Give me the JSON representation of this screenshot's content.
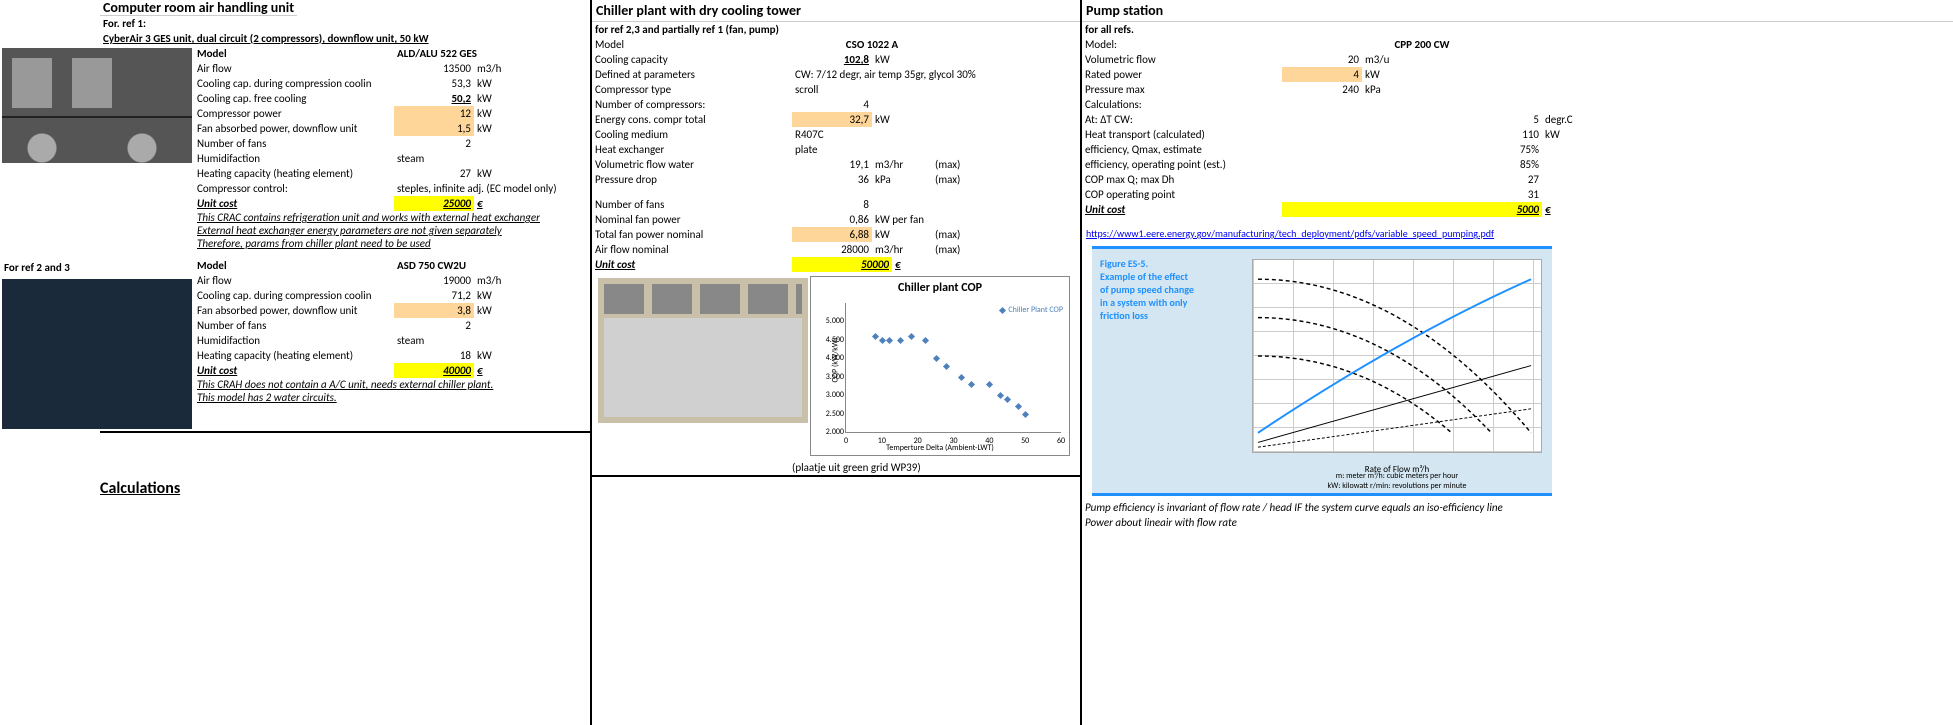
{
  "sec1": {
    "title": "Computer room air handling unit",
    "ref1_label": "For. ref 1:",
    "ref1_desc": "CyberAir 3 GES unit, dual circuit (2 compressors), downflow unit, 50 kW",
    "model_label": "Model",
    "model1": "ALD/ALU 522 GES",
    "rows1": [
      {
        "label": "Air flow",
        "val": "13500",
        "unit": "m3/h",
        "hl": ""
      },
      {
        "label": "Cooling cap. during compression coolin",
        "val": "53,3",
        "unit": "kW",
        "hl": ""
      },
      {
        "label": "Cooling cap. free cooling",
        "val": "50,2",
        "unit": "kW",
        "hl": "",
        "valcls": "und-bold"
      },
      {
        "label": "Compressor power",
        "val": "12",
        "unit": "kW",
        "hl": "hl-orange"
      },
      {
        "label": "Fan absorbed power, downflow unit",
        "val": "1,5",
        "unit": "kW",
        "hl": "hl-orange"
      },
      {
        "label": "Number of fans",
        "val": "2",
        "unit": "",
        "hl": ""
      },
      {
        "label": "Humidifaction",
        "val": "steam",
        "unit": "",
        "hl": "",
        "wide": true
      },
      {
        "label": "Heating capacity (heating element)",
        "val": "27",
        "unit": "kW",
        "hl": ""
      },
      {
        "label": "Compressor control:",
        "val": "steples, infinite adj. (EC model only)",
        "unit": "",
        "hl": "",
        "wide": true
      }
    ],
    "unitcost_label": "Unit cost",
    "unitcost1": "25000",
    "unitcost_cur": "€",
    "notes1": [
      "This CRAC contains refrigeration unit and works with external heat exchanger",
      "External heat exchanger energy parameters are not given separately",
      "Therefore, params from chiller plant need to be used"
    ],
    "ref23_label": "For ref 2 and 3",
    "model2": "ASD 750 CW2U",
    "rows2": [
      {
        "label": "Air flow",
        "val": "19000",
        "unit": "m3/h",
        "hl": ""
      },
      {
        "label": "Cooling cap. during compression coolin",
        "val": "71,2",
        "unit": "kW",
        "hl": ""
      },
      {
        "label": "Fan absorbed power, downflow unit",
        "val": "3,8",
        "unit": "kW",
        "hl": "hl-orange"
      },
      {
        "label": "Number of fans",
        "val": "2",
        "unit": "",
        "hl": ""
      },
      {
        "label": "Humidifaction",
        "val": "steam",
        "unit": "",
        "hl": "",
        "wide": true
      },
      {
        "label": "Heating capacity (heating element)",
        "val": "18",
        "unit": "kW",
        "hl": ""
      }
    ],
    "unitcost2": "40000",
    "notes2": [
      "This CRAH does not contain a A/C unit, needs external chiller plant.",
      "This model has 2 water circuits."
    ],
    "calc_title": "Calculations"
  },
  "sec2": {
    "title": "Chiller plant with dry cooling tower",
    "sub": "for ref 2,3 and partially ref 1 (fan, pump)",
    "model_label": "Model",
    "model": "CSO 1022 A",
    "rows": [
      {
        "label": "Cooling capacity",
        "val": "102,8",
        "unit": "kW",
        "hl": "",
        "valcls": "und-bold"
      },
      {
        "label": "Defined at parameters",
        "val": "CW: 7/12 degr, air temp 35gr, glycol 30%",
        "unit": "",
        "wide": true
      },
      {
        "label": "Compressor type",
        "val": "scroll",
        "unit": "",
        "wide": true
      },
      {
        "label": "Number of compressors:",
        "val": "4",
        "unit": ""
      },
      {
        "label": "Energy cons. compr total",
        "val": "32,7",
        "unit": "kW",
        "hl": "hl-orange"
      },
      {
        "label": "Cooling medium",
        "val": "R407C",
        "unit": "",
        "wide": true
      },
      {
        "label": "Heat exchanger",
        "val": "plate",
        "unit": "",
        "wide": true
      },
      {
        "label": "Volumetric flow water",
        "val": "19,1",
        "unit": "m3/hr",
        "note": "(max)"
      },
      {
        "label": "Pressure drop",
        "val": "36",
        "unit": "kPa",
        "note": "(max)"
      }
    ],
    "rows_b": [
      {
        "label": "Number of fans",
        "val": "8",
        "unit": ""
      },
      {
        "label": "Nominal fan power",
        "val": "0,86",
        "unit": "kW per fan"
      },
      {
        "label": "Total fan power nominal",
        "val": "6,88",
        "unit": "kW",
        "hl": "hl-orange",
        "note": "(max)"
      },
      {
        "label": "Air flow nominal",
        "val": "28000",
        "unit": "m3/hr",
        "note": "(max)"
      }
    ],
    "unitcost_label": "Unit cost",
    "unitcost": "50000",
    "unitcost_cur": "€",
    "chart_caption": "(plaatje uit green grid WP39)",
    "chart_title": "Chiller plant COP",
    "chart_legend": "Chiller Plant COP",
    "chart_xlabel": "Temperture Delta (Ambient-LWT)",
    "chart_ylabel": "COP (kW/kW)"
  },
  "sec3": {
    "title": "Pump station",
    "sub": "for all refs.",
    "model_label": "Model:",
    "model": "CPP 200 CW",
    "rows": [
      {
        "label": "Volumetric flow",
        "val": "20",
        "unit": "m3/u"
      },
      {
        "label": "Rated power",
        "val": "4",
        "unit": "kW",
        "hl": "hl-orange"
      },
      {
        "label": "Pressure max",
        "val": "240",
        "unit": "kPa"
      }
    ],
    "calc_label": "Calculations:",
    "calc_rows": [
      {
        "label": "At: ΔT CW:",
        "val": "5",
        "unit": "degr.C"
      },
      {
        "label": "Heat transport (calculated)",
        "val": "110",
        "unit": "kW"
      },
      {
        "label": "efficiency, Qmax, estimate",
        "val": "75%",
        "unit": ""
      },
      {
        "label": "efficiency, operating point (est.)",
        "val": "85%",
        "unit": ""
      },
      {
        "label": "COP max Q; max Dh",
        "val": "27",
        "unit": ""
      },
      {
        "label": "COP operating point",
        "val": "31",
        "unit": ""
      }
    ],
    "unitcost_label": "Unit cost",
    "unitcost": "5000",
    "unitcost_cur": "€",
    "link": "https://www1.eere.energy.gov/manufacturing/tech_deployment/pdfs/variable_speed_pumping.pdf",
    "pump_fig_title1": "Figure ES-5.",
    "pump_fig_title2": "Example of the effect",
    "pump_fig_title3": "of pump speed change",
    "pump_fig_title4": "in a system with only",
    "pump_fig_title5": "friction loss",
    "pump_xlabel": "Rate of Flow m³/h",
    "pump_foot": "m: meter    m³/h: cubic meters per hour\nkW: kilowatt   r/min: revolutions per minute",
    "footnote1": "Pump efficiency is invariant of flow rate / head IF the system curve equals an iso-efficiency line",
    "footnote2": "Power about lineair with flow rate"
  },
  "chart_data": {
    "type": "scatter",
    "title": "Chiller plant COP",
    "xlabel": "Temperture Delta (Ambient-LWT)",
    "ylabel": "COP (kW/kW)",
    "xlim": [
      0,
      60
    ],
    "ylim": [
      2.0,
      5.5
    ],
    "series": [
      {
        "name": "Chiller Plant COP",
        "x": [
          8,
          10,
          12,
          15,
          18,
          22,
          25,
          28,
          32,
          35,
          40,
          43,
          45,
          48,
          50
        ],
        "y": [
          4.6,
          4.5,
          4.5,
          4.5,
          4.6,
          4.5,
          4.0,
          3.8,
          3.5,
          3.3,
          3.3,
          3.0,
          2.9,
          2.7,
          2.5
        ]
      }
    ]
  }
}
